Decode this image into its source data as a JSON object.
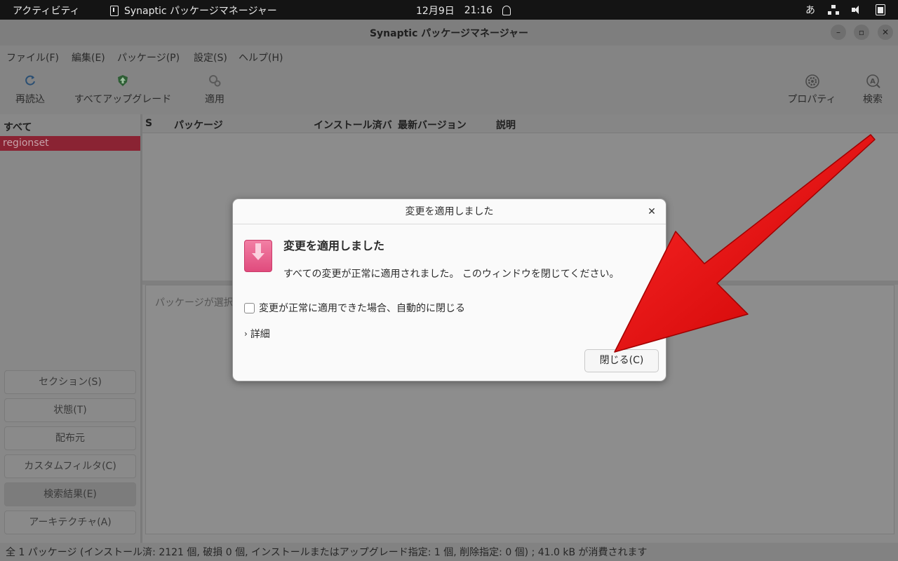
{
  "topbar": {
    "activities": "アクティビティ",
    "app_name": "Synaptic パッケージマネージャー",
    "date": "12月9日",
    "time": "21:16",
    "input_method": "あ",
    "icons": [
      "bell-icon",
      "network-icon",
      "volume-icon",
      "battery-icon"
    ]
  },
  "window": {
    "title": "Synaptic パッケージマネージャー",
    "buttons": [
      "minimize",
      "restore",
      "close"
    ]
  },
  "menubar": {
    "items": [
      "ファイル(F)",
      "編集(E)",
      "パッケージ(P)",
      "設定(S)",
      "ヘルプ(H)"
    ]
  },
  "toolbar": {
    "reload": "再読込",
    "upgrade_all": "すべてアップグレード",
    "apply": "適用",
    "properties": "プロパティ",
    "search": "検索"
  },
  "left_pane": {
    "header": "すべて",
    "selected_item": "regionset",
    "filter_buttons": [
      "セクション(S)",
      "状態(T)",
      "配布元",
      "カスタムフィルタ(C)",
      "検索結果(E)",
      "アーキテクチャ(A)"
    ]
  },
  "package_list": {
    "columns": [
      "S",
      "パッケージ",
      "インストール済バ",
      "最新バージョン",
      "説明"
    ]
  },
  "description_placeholder": "パッケージが選択",
  "statusbar": {
    "text": "全 1 パッケージ (インストール済: 2121 個, 破損 0 個, インストールまたはアップグレード指定: 1 個, 削除指定: 0 個) ; 41.0 kB が消費されます"
  },
  "dialog": {
    "title": "変更を適用しました",
    "heading": "変更を適用しました",
    "message": "すべての変更が正常に適用されました。 このウィンドウを閉じてください。",
    "auto_close_label": "変更が正常に適用できた場合、自動的に閉じる",
    "auto_close_checked": false,
    "details_label": "詳細",
    "close_button": "閉じる(C)"
  },
  "colors": {
    "selection": "#8a2333",
    "arrow": "#e00000",
    "icon_pink": "#e04b7d"
  }
}
